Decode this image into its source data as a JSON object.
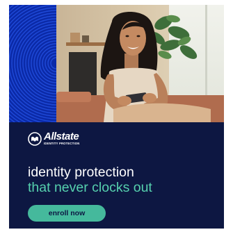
{
  "ad": {
    "brand": {
      "name": "Allstate",
      "subtitle": "IDENTITY PROTECTION",
      "logo_icon": "allstate-hands-icon"
    },
    "headline": {
      "line1": "identity protection",
      "line2": "that never clocks out"
    },
    "cta": {
      "label": "enroll now"
    },
    "hero_image": {
      "subject": "woman-with-phone-photo"
    },
    "colors": {
      "background": "#0d1742",
      "accent": "#56d1ae",
      "button": "#45b99c",
      "text": "#ffffff"
    }
  }
}
